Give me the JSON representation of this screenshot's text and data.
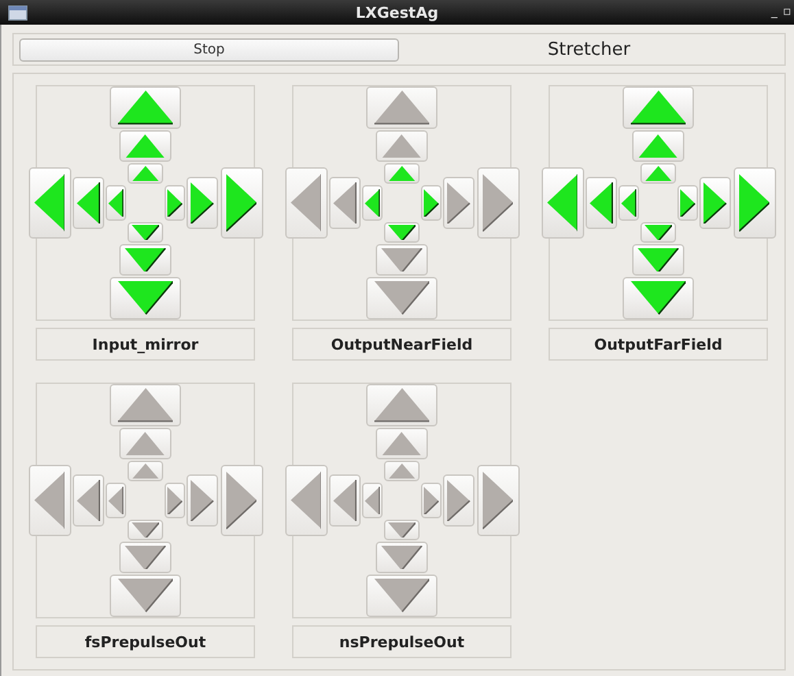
{
  "window": {
    "title": "LXGestAg",
    "controls": [
      "_",
      "▫"
    ]
  },
  "top_bar": {
    "button": "Stop",
    "title": "Stretcher"
  },
  "panels": [
    {
      "name": "Input_mirror",
      "arrows": {
        "up": [
          {
            "enabled": true
          },
          {
            "enabled": true
          },
          {
            "enabled": true
          }
        ],
        "left": [
          {
            "enabled": true
          },
          {
            "enabled": true
          },
          {
            "enabled": true
          }
        ],
        "right": [
          {
            "enabled": true
          },
          {
            "enabled": true
          },
          {
            "enabled": true
          }
        ],
        "down": [
          {
            "enabled": true
          },
          {
            "enabled": true
          },
          {
            "enabled": true
          }
        ]
      }
    },
    {
      "name": "OutputNearField",
      "arrows": {
        "up": [
          {
            "enabled": false
          },
          {
            "enabled": false
          },
          {
            "enabled": true
          }
        ],
        "left": [
          {
            "enabled": false
          },
          {
            "enabled": false
          },
          {
            "enabled": true
          }
        ],
        "right": [
          {
            "enabled": false
          },
          {
            "enabled": false
          },
          {
            "enabled": true
          }
        ],
        "down": [
          {
            "enabled": false
          },
          {
            "enabled": false
          },
          {
            "enabled": true
          }
        ]
      }
    },
    {
      "name": "OutputFarField",
      "arrows": {
        "up": [
          {
            "enabled": true
          },
          {
            "enabled": true
          },
          {
            "enabled": true
          }
        ],
        "left": [
          {
            "enabled": true
          },
          {
            "enabled": true
          },
          {
            "enabled": true
          }
        ],
        "right": [
          {
            "enabled": true
          },
          {
            "enabled": true
          },
          {
            "enabled": true
          }
        ],
        "down": [
          {
            "enabled": true
          },
          {
            "enabled": true
          },
          {
            "enabled": true
          }
        ]
      }
    },
    {
      "name": "fsPrepulseOut",
      "arrows": {
        "up": [
          {
            "enabled": false
          },
          {
            "enabled": false
          },
          {
            "enabled": false
          }
        ],
        "left": [
          {
            "enabled": false
          },
          {
            "enabled": false
          },
          {
            "enabled": false
          }
        ],
        "right": [
          {
            "enabled": false
          },
          {
            "enabled": false
          },
          {
            "enabled": false
          }
        ],
        "down": [
          {
            "enabled": false
          },
          {
            "enabled": false
          },
          {
            "enabled": false
          }
        ]
      }
    },
    {
      "name": "nsPrepulseOut",
      "arrows": {
        "up": [
          {
            "enabled": false
          },
          {
            "enabled": false
          },
          {
            "enabled": false
          }
        ],
        "left": [
          {
            "enabled": false
          },
          {
            "enabled": false
          },
          {
            "enabled": false
          }
        ],
        "right": [
          {
            "enabled": false
          },
          {
            "enabled": false
          },
          {
            "enabled": false
          }
        ],
        "down": [
          {
            "enabled": false
          },
          {
            "enabled": false
          },
          {
            "enabled": false
          }
        ]
      }
    }
  ]
}
